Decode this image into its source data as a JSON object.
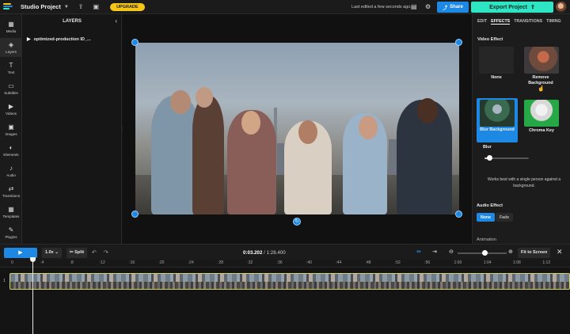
{
  "topbar": {
    "project_title": "Studio Project",
    "upgrade_label": "UPGRADE",
    "edited_text": "Last edited a few seconds ago.",
    "share_label": "Share",
    "export_label": "Export Project",
    "logo_colors": [
      "#f5c518",
      "#1e88e5",
      "#2ee6c3",
      "#ef5350"
    ]
  },
  "rail": {
    "items": [
      {
        "label": "Media",
        "icon": "media-icon",
        "glyph": "▦"
      },
      {
        "label": "Layers",
        "icon": "layers-icon",
        "glyph": "◈"
      },
      {
        "label": "Text",
        "icon": "text-icon",
        "glyph": "T"
      },
      {
        "label": "Subtitles",
        "icon": "subtitles-icon",
        "glyph": "▭"
      },
      {
        "label": "Videos",
        "icon": "videos-icon",
        "glyph": "▶"
      },
      {
        "label": "Images",
        "icon": "images-icon",
        "glyph": "▣"
      },
      {
        "label": "Elements",
        "icon": "elements-icon",
        "glyph": "◐"
      },
      {
        "label": "Audio",
        "icon": "audio-icon",
        "glyph": "♪"
      },
      {
        "label": "Transitions",
        "icon": "transitions-icon",
        "glyph": "⇄"
      },
      {
        "label": "Templates",
        "icon": "templates-icon",
        "glyph": "▦"
      },
      {
        "label": "Plugins",
        "icon": "plugins-icon",
        "glyph": "✎"
      }
    ],
    "active": "Layers"
  },
  "layers": {
    "title": "LAYERS",
    "item_name": "optimized-production ID_..."
  },
  "panel": {
    "tabs": [
      "EDIT",
      "EFFECTS",
      "TRANSITIONS",
      "TIMING"
    ],
    "active_tab": "EFFECTS",
    "video_effect_label": "Video Effect",
    "effects": [
      {
        "name": "None"
      },
      {
        "name": "Remove Background"
      },
      {
        "name": "Blur Background"
      },
      {
        "name": "Chroma Key"
      }
    ],
    "selected_effect": "Blur Background",
    "blur_label": "Blur",
    "blur_value": 0.1,
    "hint": "Works best with a single person against a background.",
    "audio_effect_label": "Audio Effect",
    "audio_options": [
      "None",
      "Fade"
    ],
    "audio_selected": "None",
    "animation_label": "Animation"
  },
  "timeline": {
    "speed": "1.0x",
    "split_label": "Split",
    "current_time": "0:03.202",
    "total_time": "1:28.400",
    "fit_label": "Fit to Screen",
    "zoom_value": 0.5,
    "ruler_ticks": [
      "0",
      ":4",
      ":8",
      ":12",
      ":16",
      ":20",
      ":24",
      ":28",
      ":32",
      ":36",
      ":40",
      ":44",
      ":48",
      ":52",
      ":56",
      "1:00",
      "1:04",
      "1:08",
      "1:12"
    ],
    "track_number": "1",
    "accent_color": "#1e88e5"
  }
}
